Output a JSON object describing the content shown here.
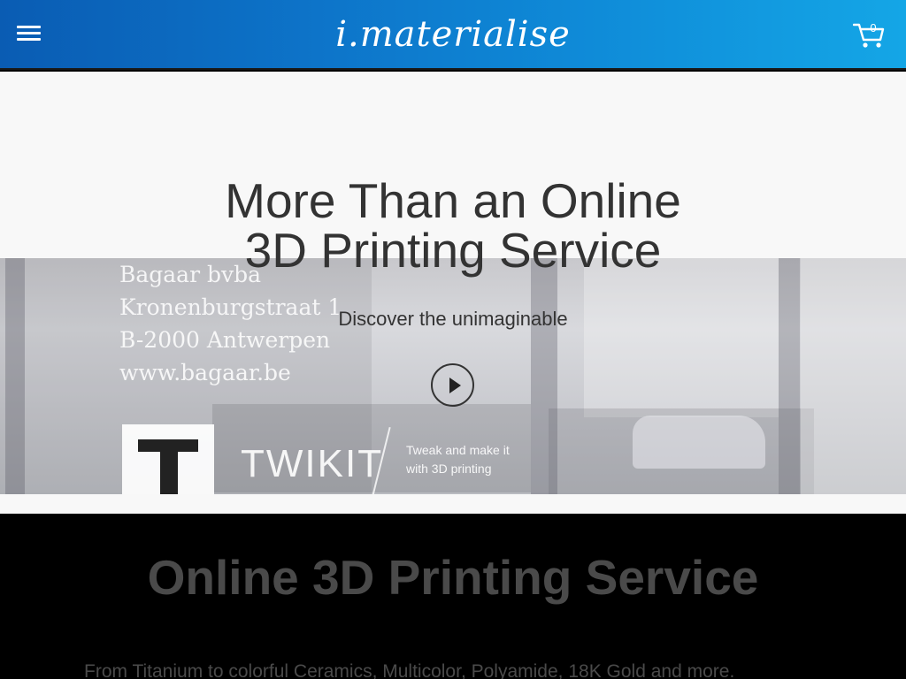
{
  "header": {
    "logo_text": "i.materialise",
    "cart_count": "0",
    "background_gradient": [
      "#0a5cb3",
      "#14a6e6"
    ]
  },
  "hero": {
    "title_line1": "More Than an Online",
    "title_line2": "3D Printing Service",
    "subtitle": "Discover the unimaginable",
    "photo": {
      "glass_lines": [
        "Bagaar bvba",
        "Kronenburgstraat 1",
        "B-2000 Antwerpen",
        "www.bagaar.be"
      ],
      "brand_word": "TWIKIT",
      "brand_tagline_1": "Tweak and make it",
      "brand_tagline_2": "with 3D printing"
    }
  },
  "section": {
    "title": "Online 3D Printing Service",
    "text": "From Titanium to colorful Ceramics, Multicolor, Polyamide, 18K Gold and more."
  },
  "colors": {
    "hero_bg": "#f8f8f8",
    "text_dark": "#333333",
    "section_bg": "#000000",
    "section_text": "#4a4a4a"
  }
}
